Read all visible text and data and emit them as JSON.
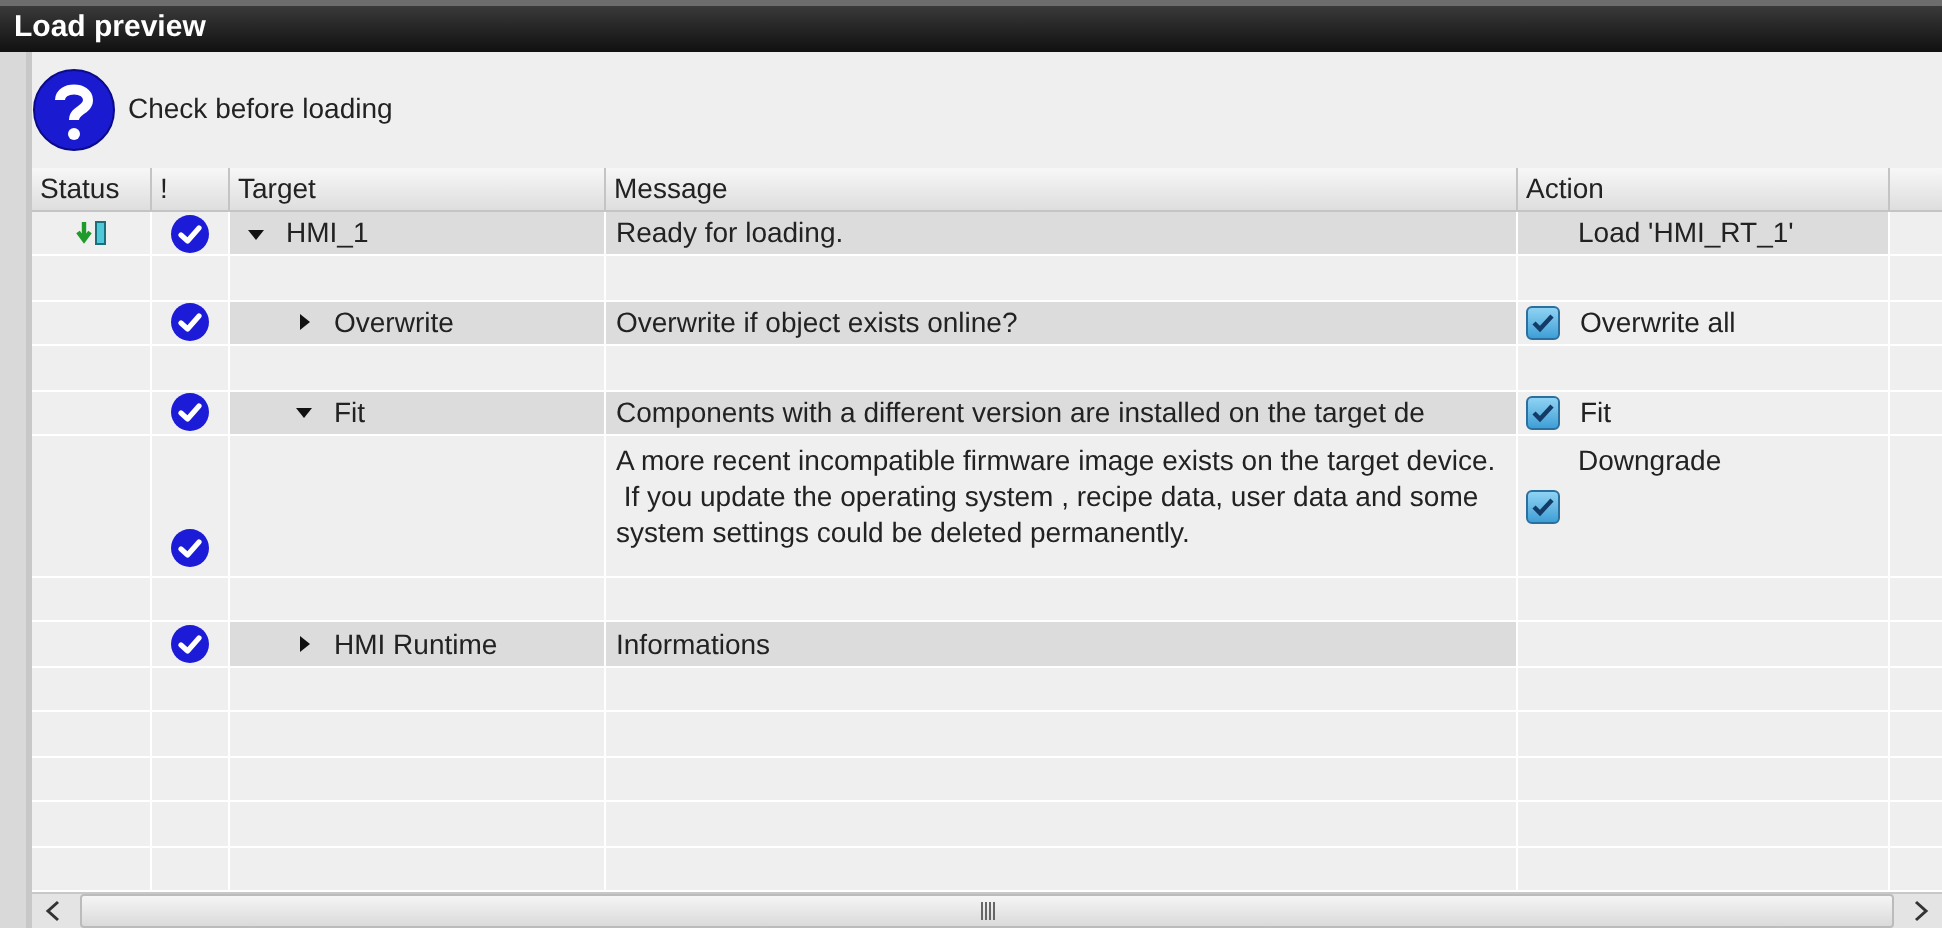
{
  "window": {
    "title": "Load preview"
  },
  "header": {
    "text": "Check before loading"
  },
  "table": {
    "columns": [
      "Status",
      "!",
      "Target",
      "Message",
      "Action"
    ],
    "rows": [
      {
        "target": "HMI_1",
        "expanded": true,
        "loading": true,
        "check": true,
        "message": "Ready for loading.",
        "action": {
          "kind": "text",
          "label": "Load 'HMI_RT_1'"
        },
        "children": [
          {
            "target": "Overwrite",
            "expanded": false,
            "check": true,
            "message": "Overwrite if object exists online?",
            "action": {
              "kind": "checkbox",
              "checked": true,
              "label": "Overwrite all"
            }
          },
          {
            "target": "Fit",
            "expanded": true,
            "check": true,
            "message": "Components with a different version are installed on the target de",
            "action": {
              "kind": "checkbox",
              "checked": true,
              "label": "Fit"
            },
            "detail": {
              "check": true,
              "lines": [
                "A more recent incompatible firmware image exists on the target device.",
                " If you update the operating system , recipe data, user data and some system settings could be deleted permanently."
              ],
              "action": {
                "label": "Downgrade",
                "checked": true
              }
            }
          },
          {
            "target": "HMI Runtime",
            "expanded": false,
            "check": true,
            "message": "Informations"
          }
        ]
      }
    ]
  }
}
